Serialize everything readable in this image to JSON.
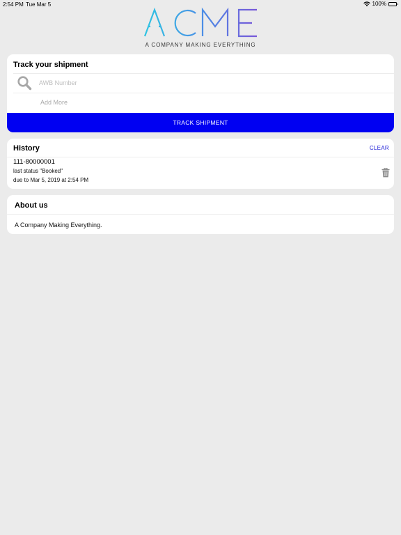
{
  "statusbar": {
    "time": "2:54 PM",
    "date": "Tue Mar 5",
    "battery": "100%",
    "icons": [
      "wifi-icon",
      "battery-icon"
    ]
  },
  "brand": {
    "logo_text": "ACME",
    "tagline": "A COMPANY MAKING EVERYTHING",
    "colors": [
      "#2fc6e2",
      "#4a8fe6",
      "#7a55d8"
    ]
  },
  "track": {
    "title": "Track your shipment",
    "awb_placeholder": "AWB Number",
    "awb_value": "",
    "add_more": "Add More",
    "button_label": "TRACK SHIPMENT",
    "button_color": "#0000f2",
    "icon": "search-icon"
  },
  "history": {
    "title": "History",
    "clear_label": "CLEAR",
    "items": [
      {
        "awb": "111-80000001",
        "status": "last status \"Booked\"",
        "due": "due to Mar 5, 2019 at 2:54 PM",
        "icon": "trash-icon"
      }
    ]
  },
  "about": {
    "title": "About us",
    "text": "A Company Making Everything."
  }
}
